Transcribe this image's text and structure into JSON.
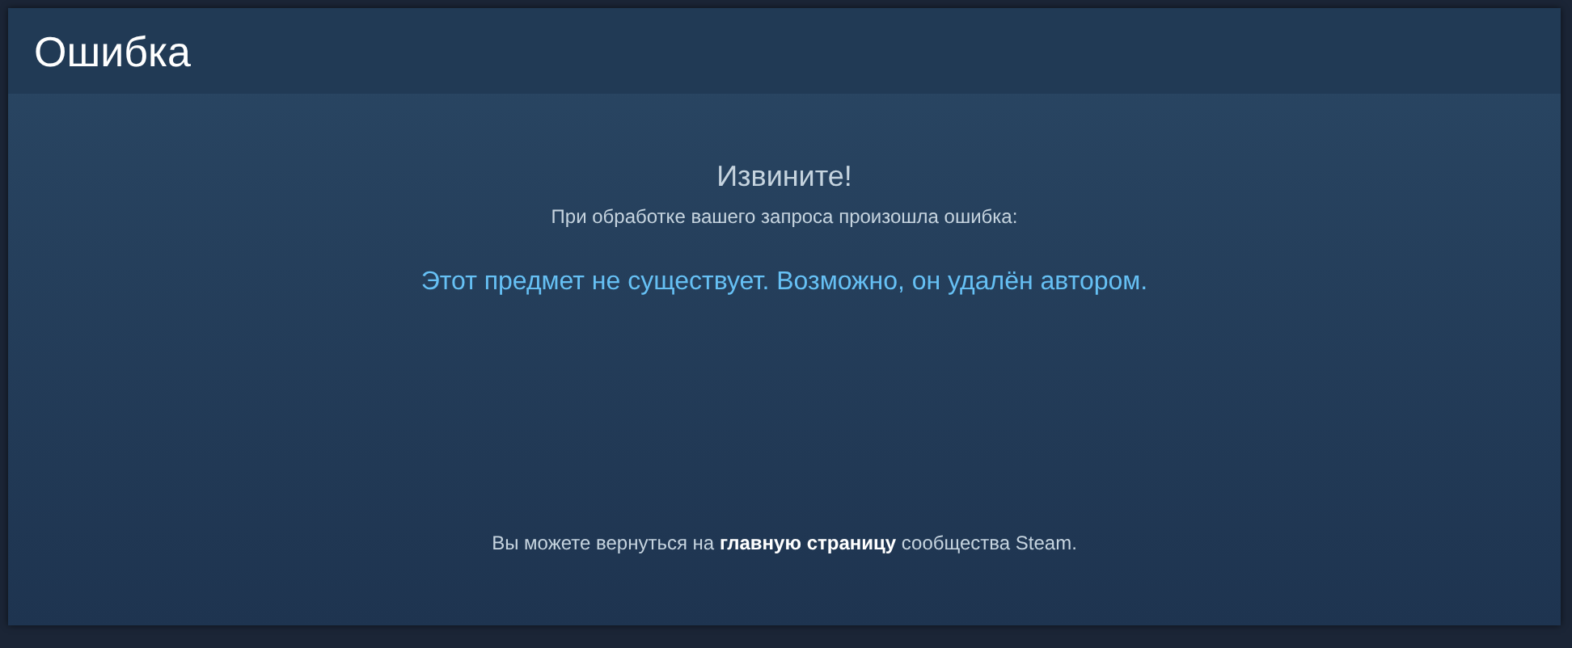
{
  "header": {
    "title": "Ошибка"
  },
  "message": {
    "heading": "Извините!",
    "subheading": "При обработке вашего запроса произошла ошибка:",
    "error": "Этот предмет не существует. Возможно, он удалён автором."
  },
  "footer": {
    "before": "Вы можете вернуться на",
    "link": "главную страницу",
    "after": "сообщества Steam."
  }
}
